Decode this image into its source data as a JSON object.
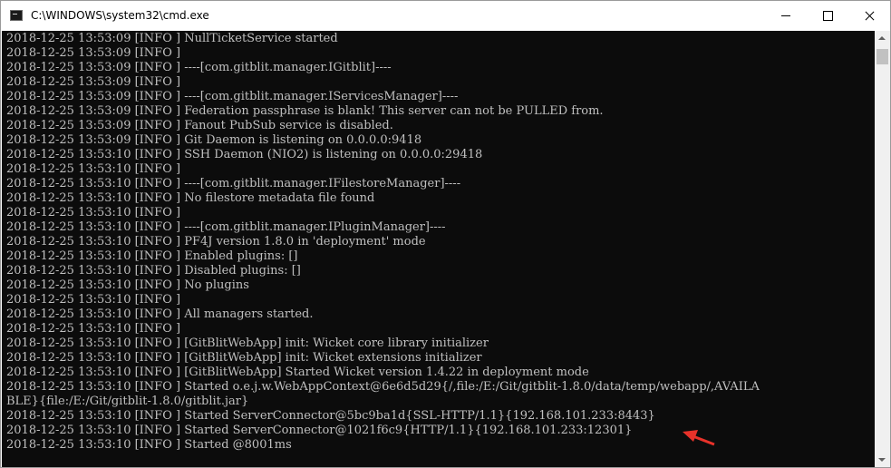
{
  "window": {
    "title": "C:\\WINDOWS\\system32\\cmd.exe",
    "controls": {
      "minimize_icon": "minimize-icon",
      "maximize_icon": "maximize-icon",
      "close_icon": "close-icon"
    }
  },
  "console": {
    "background": "#0c0c0c",
    "text_color": "#c0c0c0",
    "lines": [
      "2018-12-25 13:53:09 [INFO ] NullTicketService started",
      "2018-12-25 13:53:09 [INFO ]",
      "2018-12-25 13:53:09 [INFO ] ----[com.gitblit.manager.IGitblit]----",
      "2018-12-25 13:53:09 [INFO ]",
      "2018-12-25 13:53:09 [INFO ] ----[com.gitblit.manager.IServicesManager]----",
      "2018-12-25 13:53:09 [INFO ] Federation passphrase is blank! This server can not be PULLED from.",
      "2018-12-25 13:53:09 [INFO ] Fanout PubSub service is disabled.",
      "2018-12-25 13:53:09 [INFO ] Git Daemon is listening on 0.0.0.0:9418",
      "2018-12-25 13:53:10 [INFO ] SSH Daemon (NIO2) is listening on 0.0.0.0:29418",
      "2018-12-25 13:53:10 [INFO ]",
      "2018-12-25 13:53:10 [INFO ] ----[com.gitblit.manager.IFilestoreManager]----",
      "2018-12-25 13:53:10 [INFO ] No filestore metadata file found",
      "2018-12-25 13:53:10 [INFO ]",
      "2018-12-25 13:53:10 [INFO ] ----[com.gitblit.manager.IPluginManager]----",
      "2018-12-25 13:53:10 [INFO ] PF4J version 1.8.0 in 'deployment' mode",
      "2018-12-25 13:53:10 [INFO ] Enabled plugins: []",
      "2018-12-25 13:53:10 [INFO ] Disabled plugins: []",
      "2018-12-25 13:53:10 [INFO ] No plugins",
      "2018-12-25 13:53:10 [INFO ]",
      "2018-12-25 13:53:10 [INFO ] All managers started.",
      "2018-12-25 13:53:10 [INFO ]",
      "2018-12-25 13:53:10 [INFO ] [GitBlitWebApp] init: Wicket core library initializer",
      "2018-12-25 13:53:10 [INFO ] [GitBlitWebApp] init: Wicket extensions initializer",
      "2018-12-25 13:53:10 [INFO ] [GitBlitWebApp] Started Wicket version 1.4.22 in deployment mode",
      "2018-12-25 13:53:10 [INFO ] Started o.e.j.w.WebAppContext@6e6d5d29{/,file:/E:/Git/gitblit-1.8.0/data/temp/webapp/,AVAILA",
      "BLE}{file:/E:/Git/gitblit-1.8.0/gitblit.jar}",
      "2018-12-25 13:53:10 [INFO ] Started ServerConnector@5bc9ba1d{SSL-HTTP/1.1}{192.168.101.233:8443}",
      "2018-12-25 13:53:10 [INFO ] Started ServerConnector@1021f6c9{HTTP/1.1}{192.168.101.233:12301}",
      "2018-12-25 13:53:10 [INFO ] Started @8001ms"
    ]
  },
  "annotation": {
    "arrow_color": "#e8322a"
  }
}
